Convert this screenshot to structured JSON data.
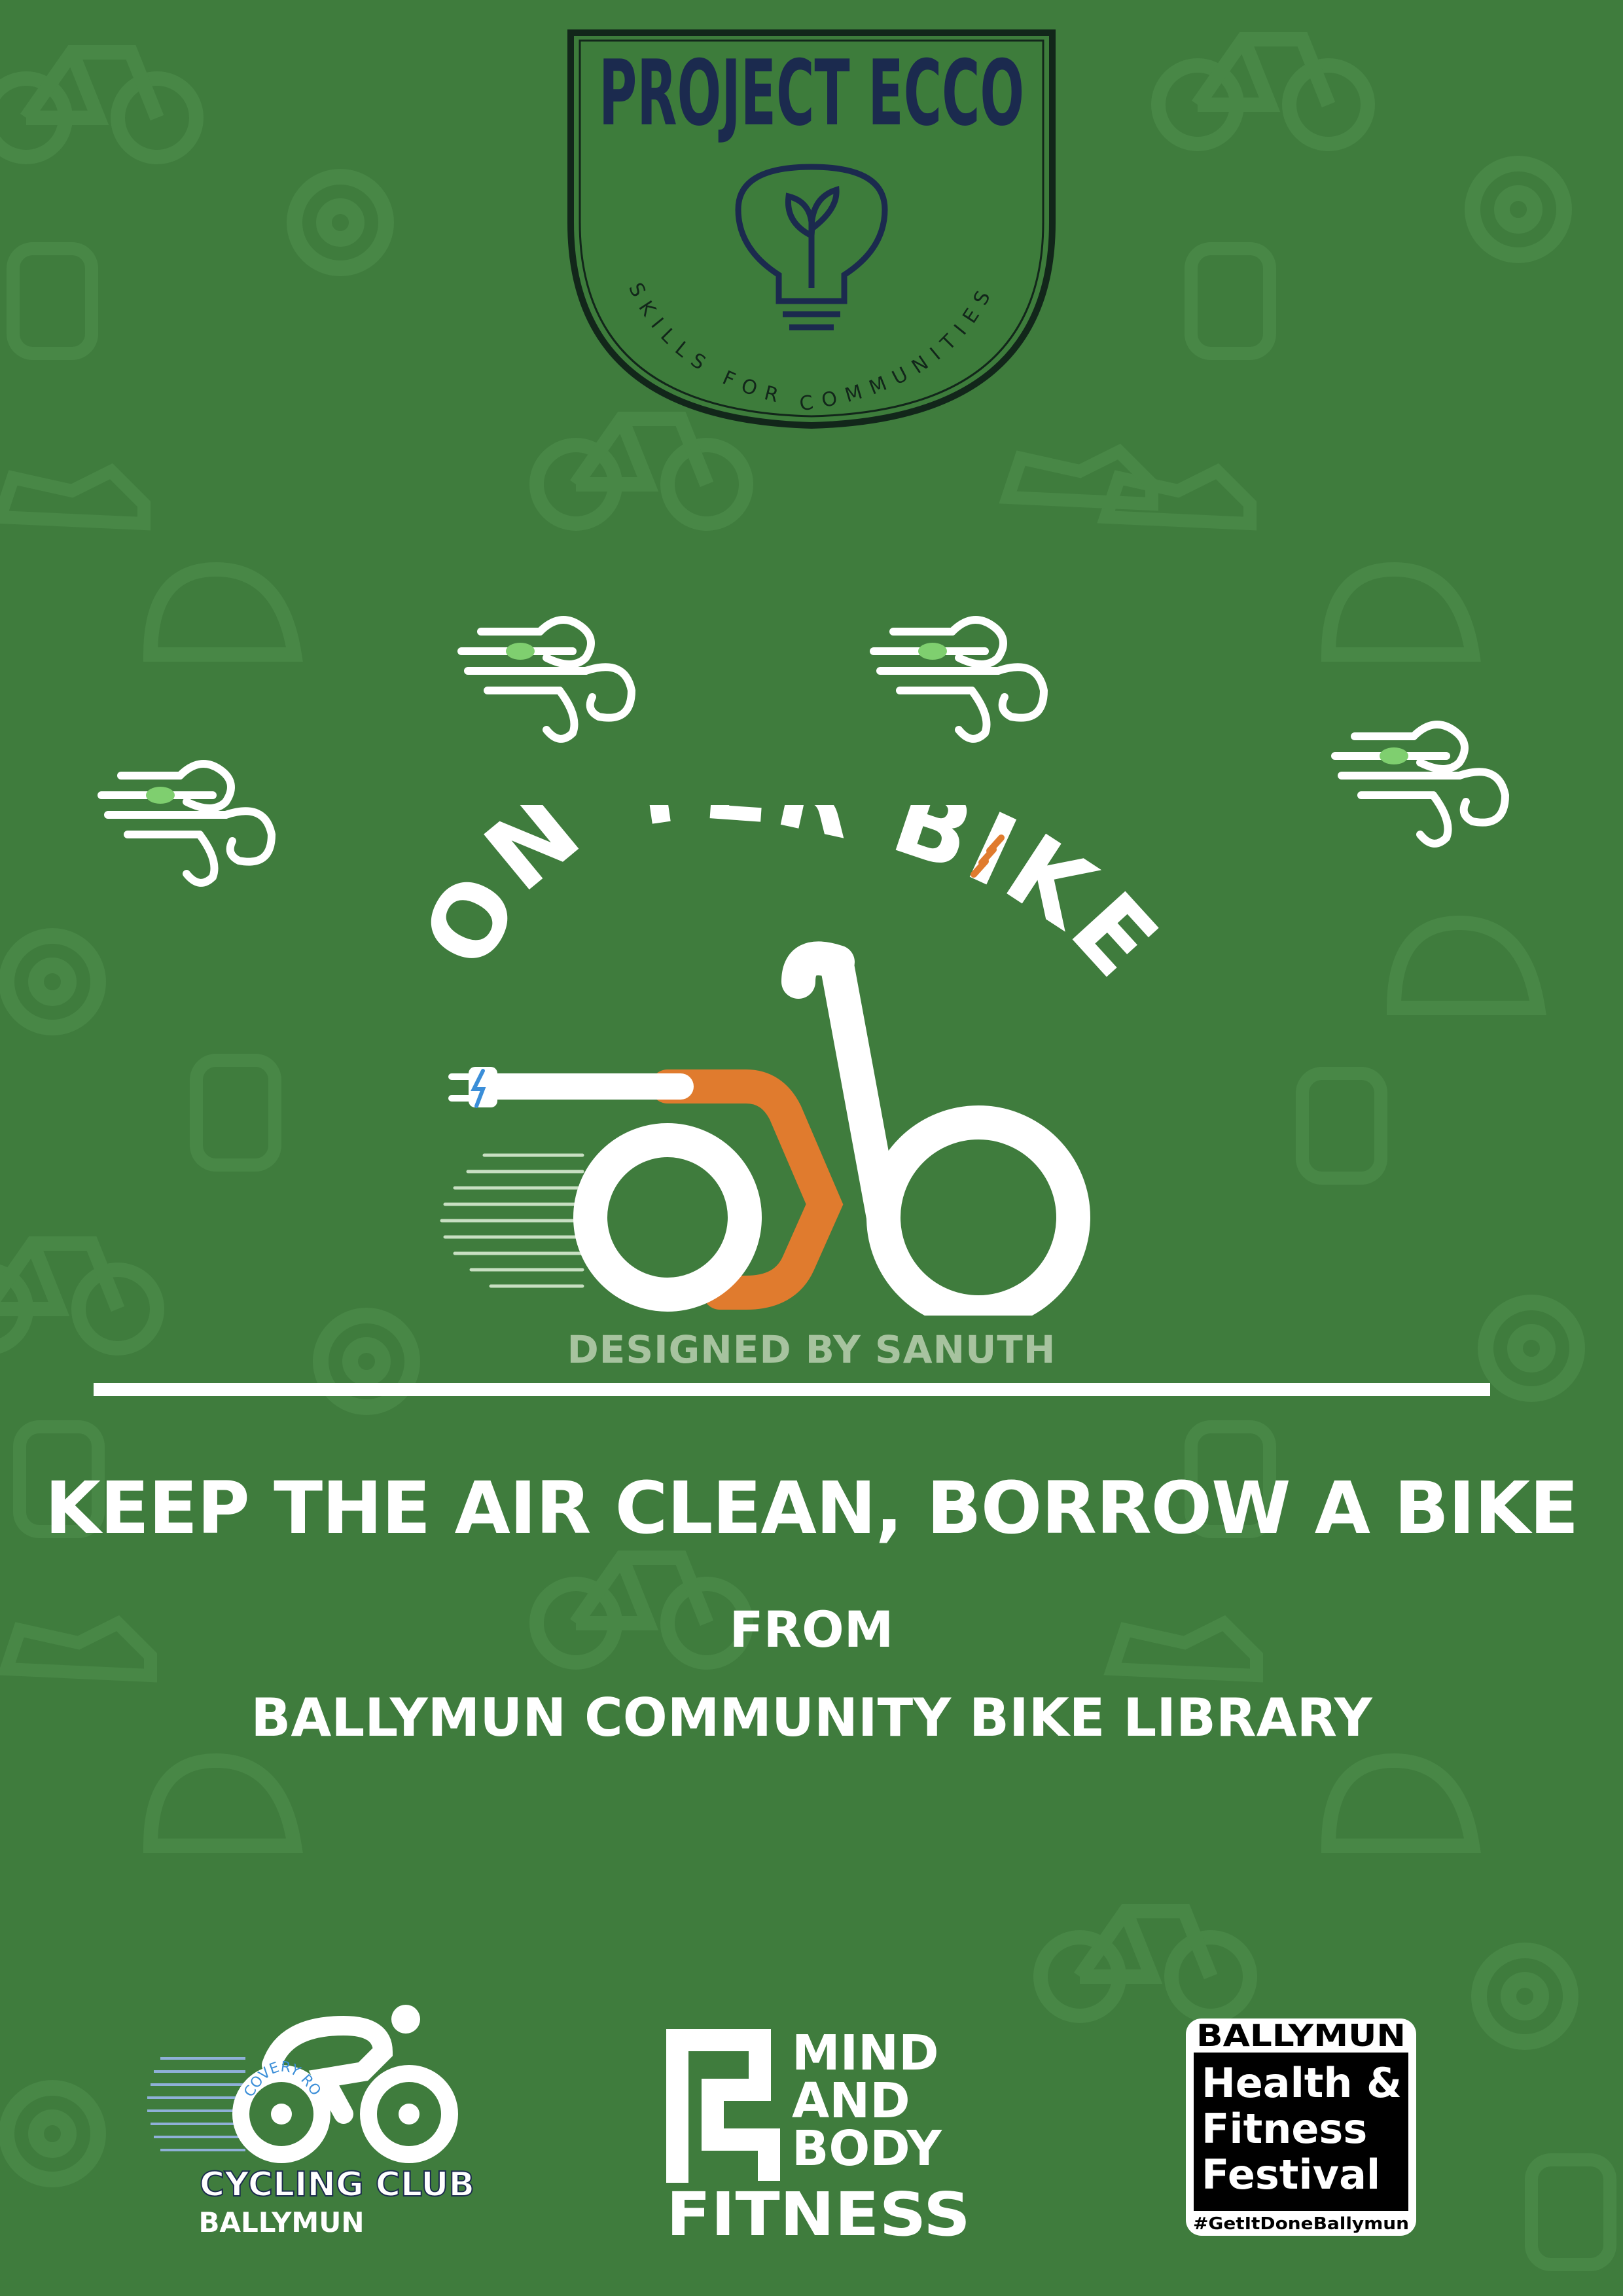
{
  "header_logo": {
    "title": "PROJECT ECCO",
    "tagline": "SKILLS FOR COMMUNITIES"
  },
  "main_logo": {
    "title": "ON YER BIKE",
    "credit": "DESIGNED BY SANUTH"
  },
  "message": {
    "headline": "KEEP THE AIR CLEAN, BORROW A BIKE",
    "connector": "FROM",
    "organization": "BALLYMUN COMMUNITY BIKE LIBRARY"
  },
  "partners": [
    {
      "name": "CYCLING CLUB",
      "sub": "BALLYMUN",
      "badge": "RECOVERY ROAD"
    },
    {
      "line1": "MIND",
      "line2": "AND",
      "line3": "BODY",
      "line4": "FITNESS"
    },
    {
      "top": "BALLYMUN",
      "line1": "Health &",
      "line2": "Fitness",
      "line3": "Festival",
      "hashtag": "#GetItDoneBallymun"
    }
  ],
  "colors": {
    "background": "#3f7c3d",
    "pattern": "#4a8647",
    "accent_orange": "#e07b2e",
    "navy": "#1b2a4e",
    "white": "#ffffff"
  }
}
